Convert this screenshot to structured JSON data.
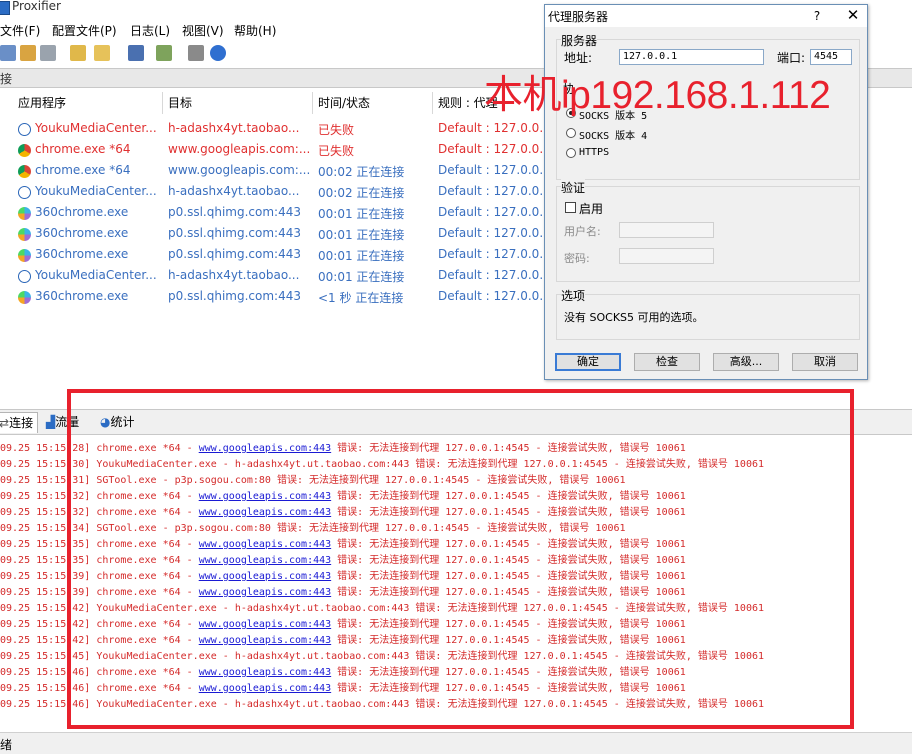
{
  "window": {
    "title": "Proxifier"
  },
  "menu": [
    "文件(F)",
    "配置文件(P)",
    "日志(L)",
    "视图(V)",
    "帮助(H)"
  ],
  "toolbar_icons": [
    "options-icon",
    "profile-icon",
    "speed-icon",
    "open-icon",
    "folder-icon",
    "save-icon",
    "import-icon",
    "print-icon",
    "help-icon"
  ],
  "section_label": "接",
  "connections": {
    "columns": [
      "应用程序",
      "目标",
      "时间/状态",
      "规则 : 代理"
    ],
    "rows": [
      {
        "icon": "youku",
        "app": "YoukuMediaCenter...",
        "target": "h-adashx4yt.taobao...",
        "status": "已失败",
        "rule": "Default : 127.0.0.1:",
        "color": "red"
      },
      {
        "icon": "chrome",
        "app": "chrome.exe *64",
        "target": "www.googleapis.com:...",
        "status": "已失败",
        "rule": "Default : 127.0.0.1:",
        "color": "red"
      },
      {
        "icon": "chrome",
        "app": "chrome.exe *64",
        "target": "www.googleapis.com:...",
        "status": "00:02 正在连接",
        "rule": "Default : 127.0.0.1:",
        "color": "blue"
      },
      {
        "icon": "youku",
        "app": "YoukuMediaCenter...",
        "target": "h-adashx4yt.taobao...",
        "status": "00:02 正在连接",
        "rule": "Default : 127.0.0.1:",
        "color": "blue"
      },
      {
        "icon": "360",
        "app": "360chrome.exe",
        "target": "p0.ssl.qhimg.com:443",
        "status": "00:01 正在连接",
        "rule": "Default : 127.0.0.1:",
        "color": "blue"
      },
      {
        "icon": "360",
        "app": "360chrome.exe",
        "target": "p0.ssl.qhimg.com:443",
        "status": "00:01 正在连接",
        "rule": "Default : 127.0.0.1:",
        "color": "blue"
      },
      {
        "icon": "360",
        "app": "360chrome.exe",
        "target": "p0.ssl.qhimg.com:443",
        "status": "00:01 正在连接",
        "rule": "Default : 127.0.0.1:",
        "color": "blue"
      },
      {
        "icon": "youku",
        "app": "YoukuMediaCenter...",
        "target": "h-adashx4yt.taobao...",
        "status": "00:01 正在连接",
        "rule": "Default : 127.0.0.1:",
        "color": "blue"
      },
      {
        "icon": "360",
        "app": "360chrome.exe",
        "target": "p0.ssl.qhimg.com:443",
        "status": "<1 秒 正在连接",
        "rule": "Default : 127.0.0.1:",
        "color": "blue"
      }
    ]
  },
  "tabs": [
    "连接",
    "流量",
    "统计"
  ],
  "log": [
    {
      "time": "09.25 15:15:28]",
      "pre": "chrome.exe *64 - ",
      "link": "www.googleapis.com:443",
      "post": " 错误: 无法连接到代理 127.0.0.1:4545 - 连接尝试失败, 错误号 10061"
    },
    {
      "time": "09.25 15:15:30]",
      "pre": "YoukuMediaCenter.exe - h-adashx4yt.ut.taobao.com:443 错误: 无法连接到代理 127.0.0.1:4545 - 连接尝试失败, 错误号 10061",
      "link": "",
      "post": ""
    },
    {
      "time": "09.25 15:15:31]",
      "pre": "SGTool.exe - p3p.sogou.com:80 错误: 无法连接到代理 127.0.0.1:4545 - 连接尝试失败, 错误号 10061",
      "link": "",
      "post": ""
    },
    {
      "time": "09.25 15:15:32]",
      "pre": "chrome.exe *64 - ",
      "link": "www.googleapis.com:443",
      "post": " 错误: 无法连接到代理 127.0.0.1:4545 - 连接尝试失败, 错误号 10061"
    },
    {
      "time": "09.25 15:15:32]",
      "pre": "chrome.exe *64 - ",
      "link": "www.googleapis.com:443",
      "post": " 错误: 无法连接到代理 127.0.0.1:4545 - 连接尝试失败, 错误号 10061"
    },
    {
      "time": "09.25 15:15:34]",
      "pre": "SGTool.exe - p3p.sogou.com:80 错误: 无法连接到代理 127.0.0.1:4545 - 连接尝试失败, 错误号 10061",
      "link": "",
      "post": ""
    },
    {
      "time": "09.25 15:15:35]",
      "pre": "chrome.exe *64 - ",
      "link": "www.googleapis.com:443",
      "post": " 错误: 无法连接到代理 127.0.0.1:4545 - 连接尝试失败, 错误号 10061"
    },
    {
      "time": "09.25 15:15:35]",
      "pre": "chrome.exe *64 - ",
      "link": "www.googleapis.com:443",
      "post": " 错误: 无法连接到代理 127.0.0.1:4545 - 连接尝试失败, 错误号 10061"
    },
    {
      "time": "09.25 15:15:39]",
      "pre": "chrome.exe *64 - ",
      "link": "www.googleapis.com:443",
      "post": " 错误: 无法连接到代理 127.0.0.1:4545 - 连接尝试失败, 错误号 10061"
    },
    {
      "time": "09.25 15:15:39]",
      "pre": "chrome.exe *64 - ",
      "link": "www.googleapis.com:443",
      "post": " 错误: 无法连接到代理 127.0.0.1:4545 - 连接尝试失败, 错误号 10061"
    },
    {
      "time": "09.25 15:15:42]",
      "pre": "YoukuMediaCenter.exe - h-adashx4yt.ut.taobao.com:443 错误: 无法连接到代理 127.0.0.1:4545 - 连接尝试失败, 错误号 10061",
      "link": "",
      "post": ""
    },
    {
      "time": "09.25 15:15:42]",
      "pre": "chrome.exe *64 - ",
      "link": "www.googleapis.com:443",
      "post": " 错误: 无法连接到代理 127.0.0.1:4545 - 连接尝试失败, 错误号 10061"
    },
    {
      "time": "09.25 15:15:42]",
      "pre": "chrome.exe *64 - ",
      "link": "www.googleapis.com:443",
      "post": " 错误: 无法连接到代理 127.0.0.1:4545 - 连接尝试失败, 错误号 10061"
    },
    {
      "time": "09.25 15:15:45]",
      "pre": "YoukuMediaCenter.exe - h-adashx4yt.ut.taobao.com:443 错误: 无法连接到代理 127.0.0.1:4545 - 连接尝试失败, 错误号 10061",
      "link": "",
      "post": ""
    },
    {
      "time": "09.25 15:15:46]",
      "pre": "chrome.exe *64 - ",
      "link": "www.googleapis.com:443",
      "post": " 错误: 无法连接到代理 127.0.0.1:4545 - 连接尝试失败, 错误号 10061"
    },
    {
      "time": "09.25 15:15:46]",
      "pre": "chrome.exe *64 - ",
      "link": "www.googleapis.com:443",
      "post": " 错误: 无法连接到代理 127.0.0.1:4545 - 连接尝试失败, 错误号 10061"
    },
    {
      "time": "09.25 15:15:46]",
      "pre": "YoukuMediaCenter.exe - h-adashx4yt.ut.taobao.com:443 错误: 无法连接到代理 127.0.0.1:4545 - 连接尝试失败, 错误号 10061",
      "link": "",
      "post": ""
    }
  ],
  "statusbar": "绪",
  "annotation": {
    "text": "本机ip192.168.1.112",
    "color": "#e8212d"
  },
  "dialog": {
    "title": "代理服务器",
    "help": "?",
    "close": "✕",
    "server_group": "服务器",
    "address_label": "地址:",
    "address_value": "127.0.0.1",
    "port_label": "端口:",
    "port_value": "4545",
    "protocol_label": "协",
    "protocols": [
      "SOCKS 版本 5",
      "SOCKS 版本 4",
      "HTTPS"
    ],
    "auth_group": "验证",
    "enable_label": "启用",
    "username_label": "用户名:",
    "password_label": "密码:",
    "options_group": "选项",
    "options_text": "没有 SOCKS5 可用的选项。",
    "buttons": [
      "确定",
      "检查",
      "高级...",
      "取消"
    ]
  }
}
